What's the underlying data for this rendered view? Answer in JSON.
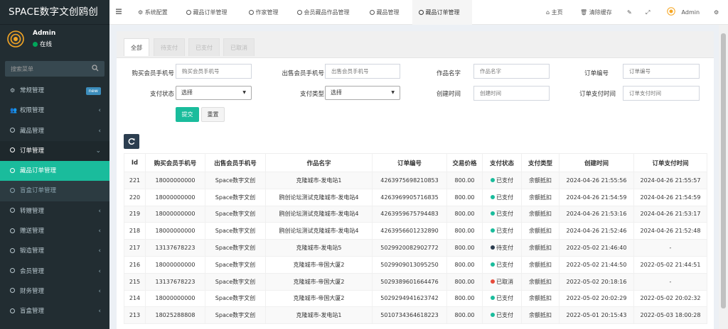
{
  "app": {
    "brand": "SPACE数字文创鸥创"
  },
  "user": {
    "name": "Admin",
    "status": "在线"
  },
  "sidebar": {
    "search_placeholder": "搜索菜单",
    "items": [
      {
        "label": "常规管理",
        "badge": "new"
      },
      {
        "label": "权限管理"
      },
      {
        "label": "藏品管理"
      },
      {
        "label": "订单管理"
      },
      {
        "label": "藏品订单管理"
      },
      {
        "label": "盲盒订单管理"
      },
      {
        "label": "转赠管理"
      },
      {
        "label": "赠送管理"
      },
      {
        "label": "锻造管理"
      },
      {
        "label": "会员管理"
      },
      {
        "label": "财务管理"
      },
      {
        "label": "盲盒管理"
      }
    ]
  },
  "topnav": {
    "tabs": [
      "系统配置",
      "藏品订单管理",
      "作家管理",
      "会员藏品作品管理",
      "藏品管理",
      "藏品订单管理"
    ],
    "home": "主页",
    "clear_cache": "清除缓存",
    "admin": "Admin"
  },
  "page_tabs": [
    "全部",
    "待支付",
    "已支付",
    "已取消"
  ],
  "filters": {
    "buyer_phone": {
      "label": "购买会员手机号",
      "placeholder": "购买会员手机号"
    },
    "seller_phone": {
      "label": "出售会员手机号",
      "placeholder": "出售会员手机号"
    },
    "work_name": {
      "label": "作品名字",
      "placeholder": "作品名字"
    },
    "order_no": {
      "label": "订单编号",
      "placeholder": "订单编号"
    },
    "pay_status": {
      "label": "支付状态",
      "value": "选择"
    },
    "pay_type": {
      "label": "支付类型",
      "value": "选择"
    },
    "create_time": {
      "label": "创建时间",
      "placeholder": "创建时间"
    },
    "pay_time": {
      "label": "订单支付时间",
      "placeholder": "订单支付时间"
    },
    "submit": "提交",
    "reset": "重置"
  },
  "table": {
    "columns": [
      "Id",
      "购买会员手机号",
      "出售会员手机号",
      "作品名字",
      "订单编号",
      "交易价格",
      "支付状态",
      "支付类型",
      "创建时间",
      "订单支付时间"
    ],
    "rows": [
      [
        "221",
        "18000000000",
        "Space数字文创",
        "克隆城市-发电站1",
        "4263975698210853",
        "800.00",
        "已支付",
        "余额抵扣",
        "2024-04-26 21:55:56",
        "2024-04-26 21:55:57"
      ],
      [
        "220",
        "18000000000",
        "Space数字文创",
        "鸥创论坛测试克隆城市-发电站4",
        "4263969905716835",
        "800.00",
        "已支付",
        "余额抵扣",
        "2024-04-26 21:54:59",
        "2024-04-26 21:54:59"
      ],
      [
        "219",
        "18000000000",
        "Space数字文创",
        "鸥创论坛测试克隆城市-发电站4",
        "4263959675794483",
        "800.00",
        "已支付",
        "余额抵扣",
        "2024-04-26 21:53:16",
        "2024-04-26 21:53:17"
      ],
      [
        "218",
        "18000000000",
        "Space数字文创",
        "鸥创论坛测试克隆城市-发电站4",
        "4263956601232890",
        "800.00",
        "已支付",
        "余额抵扣",
        "2024-04-26 21:52:46",
        "2024-04-26 21:52:48"
      ],
      [
        "217",
        "13137678223",
        "Space数字文创",
        "克隆城市-发电站5",
        "5029920082902772",
        "800.00",
        "待支付",
        "余额抵扣",
        "2022-05-02 21:46:40",
        "-"
      ],
      [
        "216",
        "18000000000",
        "Space数字文创",
        "克隆城市-帝国大厦2",
        "5029909013095250",
        "800.00",
        "已支付",
        "余额抵扣",
        "2022-05-02 21:44:50",
        "2022-05-02 21:44:51"
      ],
      [
        "215",
        "13137678223",
        "Space数字文创",
        "克隆城市-帝国大厦2",
        "5029389601664476",
        "800.00",
        "已取消",
        "余额抵扣",
        "2022-05-02 20:18:16",
        "-"
      ],
      [
        "214",
        "18000000000",
        "Space数字文创",
        "克隆城市-帝国大厦2",
        "5029294941623742",
        "800.00",
        "已支付",
        "余额抵扣",
        "2022-05-02 20:02:29",
        "2022-05-02 20:02:32"
      ],
      [
        "213",
        "18025288808",
        "Space数字文创",
        "克隆城市-发电站1",
        "5010734364618223",
        "800.00",
        "已支付",
        "余额抵扣",
        "2022-05-01 20:15:43",
        "2022-05-03 18:00:28"
      ]
    ]
  },
  "colors": {
    "sidebar_bg": "#222d32",
    "accent": "#1abc9c",
    "cancel": "#e74c3c"
  }
}
